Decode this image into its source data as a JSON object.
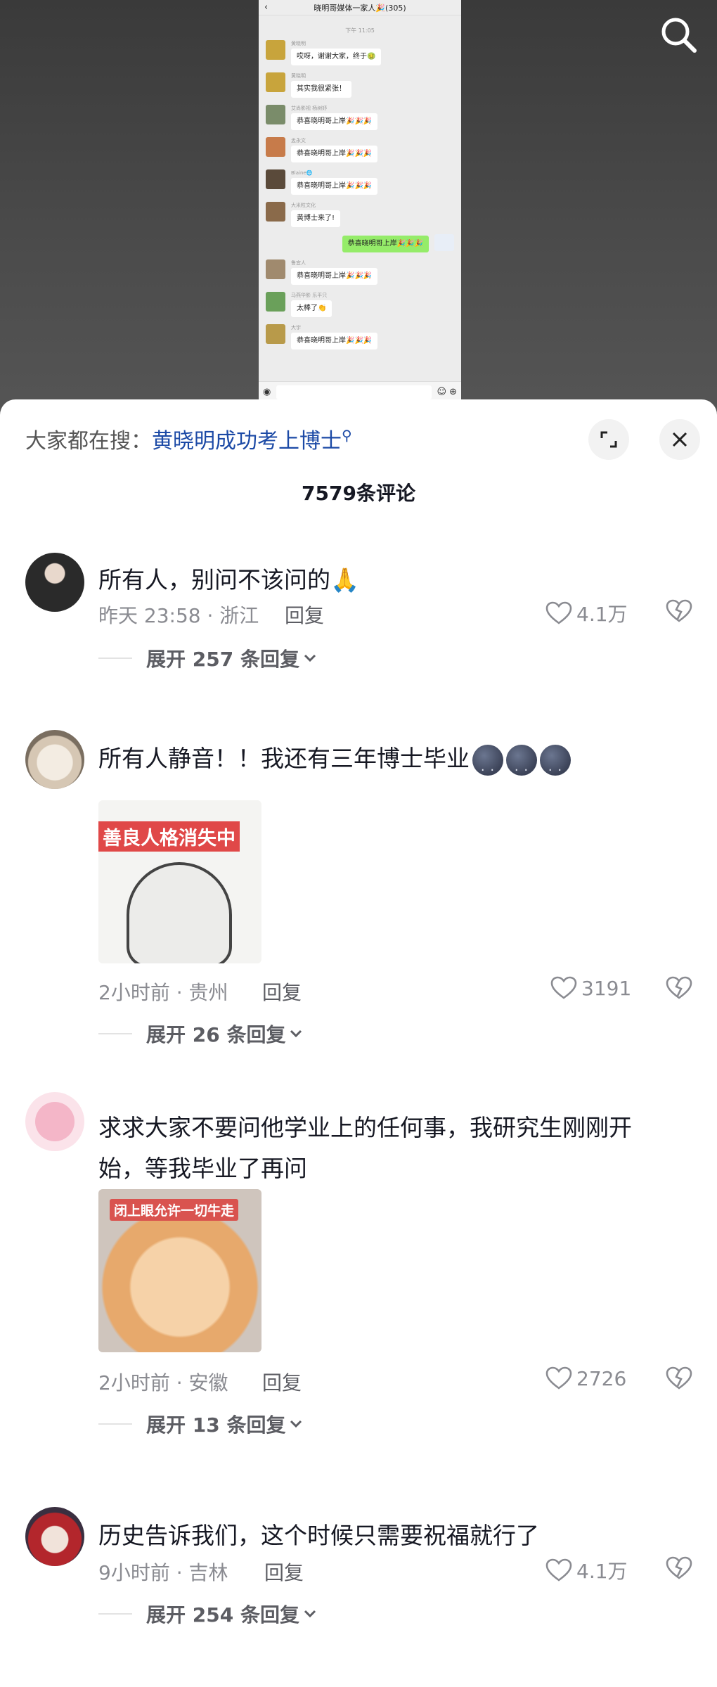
{
  "video": {
    "chat_title": "晓明哥媒体一家人🎉(305)",
    "chat_time": "下午 11:05",
    "messages": [
      {
        "name": "黄晓明",
        "text": "哎呀，谢谢大家，终于🤢",
        "avatar_color": "#c8a43c",
        "self": false
      },
      {
        "name": "黄晓明",
        "text": "其实我很紧张！",
        "avatar_color": "#c8a43c",
        "self": false
      },
      {
        "name": "艾尚影视 杨树妤",
        "text": "恭喜晓明哥上岸🎉🎉🎉",
        "avatar_color": "#7a8c6a",
        "self": false
      },
      {
        "name": "孟永文",
        "text": "恭喜晓明哥上岸🎉🎉🎉",
        "avatar_color": "#c77b4a",
        "self": false
      },
      {
        "name": "Blaine🌐",
        "text": "恭喜晓明哥上岸🎉🎉🎉",
        "avatar_color": "#5a4a3a",
        "self": false
      },
      {
        "name": "大米粒文化",
        "text": "黄博士来了!",
        "avatar_color": "#8a6a4a",
        "self": false
      },
      {
        "name": "",
        "text": "恭喜晓明哥上岸🎉🎉🎉",
        "avatar_color": "#e8eef7",
        "self": true
      },
      {
        "name": "鲁宜人",
        "text": "恭喜晓明哥上岸🎉🎉🎉",
        "avatar_color": "#a08a6e",
        "self": false
      },
      {
        "name": "马燕华影 乐平只",
        "text": "太棒了👏",
        "avatar_color": "#6aa05a",
        "self": false
      },
      {
        "name": "大宇",
        "text": "恭喜晓明哥上岸🎉🎉🎉",
        "avatar_color": "#b89a4a",
        "self": false
      }
    ]
  },
  "panel": {
    "search_prefix": "大家都在搜：",
    "search_keyword": "黄晓明成功考上博士",
    "comment_count": "7579条评论"
  },
  "comments": [
    {
      "text": "所有人，别问不该问的🙏",
      "time": "昨天 23:58 · 浙江",
      "reply": "回复",
      "likes": "4.1万",
      "expand": "展开 257 条回复"
    },
    {
      "text": "所有人静音！！我还有三年博士毕业",
      "time": "2小时前 · 贵州",
      "reply": "回复",
      "likes": "3191",
      "expand": "展开 26 条回复",
      "image_text": "善良人格消失中"
    },
    {
      "text": "求求大家不要问他学业上的任何事，我研究生刚刚开始，等我毕业了再问",
      "time": "2小时前 · 安徽",
      "reply": "回复",
      "likes": "2726",
      "expand": "展开 13 条回复",
      "image_text": "闭上眼允许一切牛走"
    },
    {
      "text": "历史告诉我们，这个时候只需要祝福就行了",
      "time": "9小时前 · 吉林",
      "reply": "回复",
      "likes": "4.1万",
      "expand": "展开 254 条回复"
    }
  ],
  "icons": {
    "search": "search-icon",
    "expand": "expand-icon",
    "close": "close-icon",
    "like": "heart-icon",
    "dislike": "broken-heart-icon",
    "chevron": "chevron-down-icon"
  },
  "colors": {
    "keyword": "#1c4aa6",
    "meta": "#8a8b91",
    "text": "#161823"
  }
}
